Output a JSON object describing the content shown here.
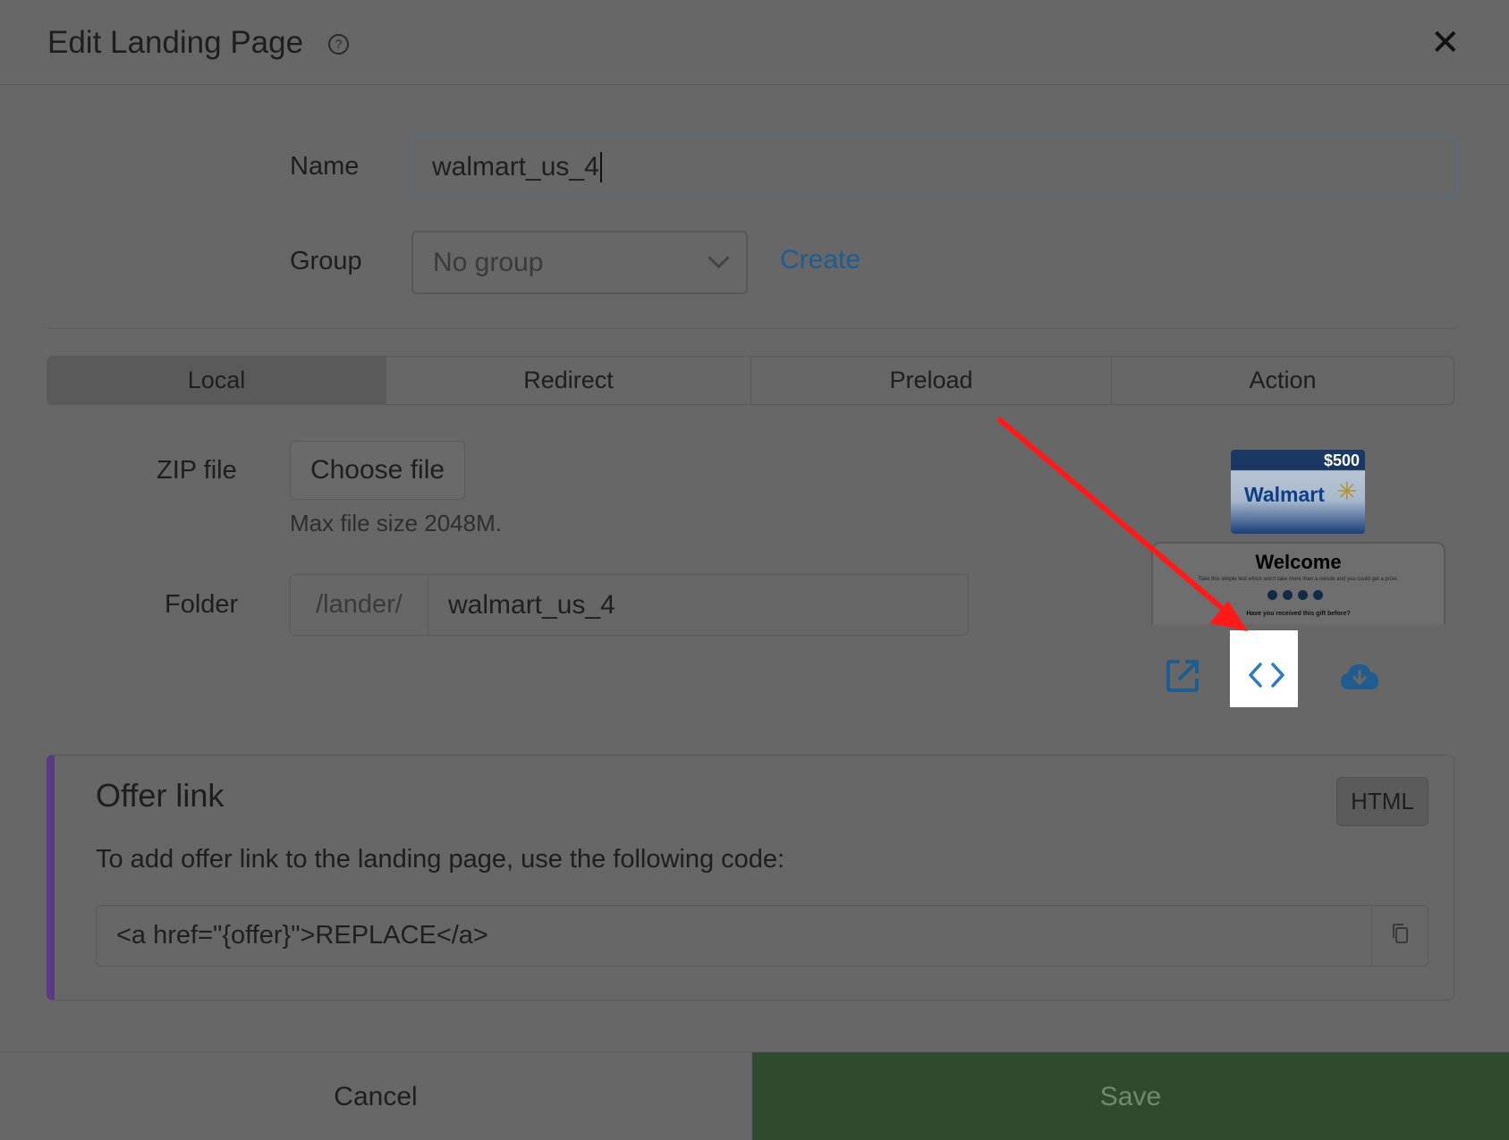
{
  "header": {
    "title": "Edit Landing Page",
    "help_glyph": "?",
    "close_glyph": "✕"
  },
  "form": {
    "name_label": "Name",
    "name_value": "walmart_us_4",
    "group_label": "Group",
    "group_value": "No group",
    "create_link": "Create"
  },
  "tabs": [
    {
      "label": "Local",
      "active": true
    },
    {
      "label": "Redirect",
      "active": false
    },
    {
      "label": "Preload",
      "active": false
    },
    {
      "label": "Action",
      "active": false
    }
  ],
  "local": {
    "zip_label": "ZIP file",
    "choose_button": "Choose file",
    "max_size_hint": "Max file size 2048M.",
    "folder_label": "Folder",
    "folder_prefix": "/lander/",
    "folder_value": "walmart_us_4"
  },
  "preview": {
    "card_amount": "$500",
    "card_brand": "Walmart",
    "welcome": "Welcome",
    "subtext": "Take this simple test which won't take more than a minute and you could get a prize.",
    "steps": [
      "1",
      "2",
      "3",
      "4"
    ],
    "question": "Have you received this gift before?",
    "icons": [
      "open-external-icon",
      "code-icon",
      "cloud-download-icon"
    ]
  },
  "offer": {
    "title": "Offer link",
    "badge": "HTML",
    "description": "To add offer link to the landing page, use the following code:",
    "code": "<a href=\"{offer}\">REPLACE</a>",
    "copy_icon": "copy-icon"
  },
  "footer": {
    "cancel": "Cancel",
    "save": "Save"
  },
  "colors": {
    "overlay_bg": "#676767",
    "link": "#1f5c8f",
    "action_icons": "#1f5c8f",
    "highlight_icon": "#2b78c4",
    "offer_accent": "#5a3a86",
    "save_bg": "#2f4a2f",
    "annotation_arrow": "#ff1a1a"
  }
}
